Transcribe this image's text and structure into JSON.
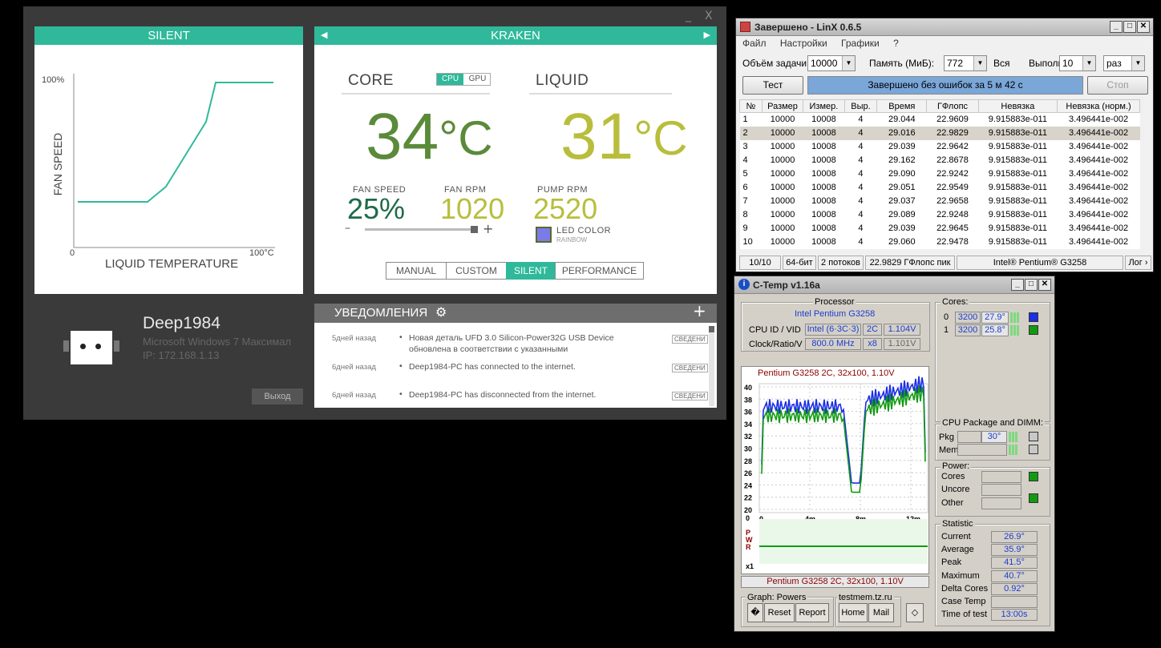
{
  "cam": {
    "window_controls": {
      "minimize": "_",
      "close": "X"
    },
    "silent": {
      "title": "SILENT",
      "y_top": "100%",
      "y_label": "FAN SPEED",
      "x_start": "0",
      "x_end": "100°C",
      "x_label": "LIQUID TEMPERATURE"
    },
    "kraken": {
      "title": "KRAKEN",
      "core_title": "CORE",
      "cpu_tab": "CPU",
      "gpu_tab": "GPU",
      "liquid_title": "LIQUID",
      "core_temp": "34",
      "liquid_temp": "31",
      "temp_unit": "°C",
      "fan_speed_label": "FAN SPEED",
      "fan_speed_value": "25%",
      "fan_rpm_label": "FAN RPM",
      "fan_rpm_value": "1020",
      "pump_rpm_label": "PUMP RPM",
      "pump_rpm_value": "2520",
      "led_color_label": "LED COLOR",
      "led_mode": "RAINBOW",
      "slider_minus": "–",
      "slider_plus": "+",
      "fan_speed_fraction": 0.98,
      "led_color": "#7b7be8",
      "modes": [
        "MANUAL",
        "CUSTOM",
        "SILENT",
        "PERFORMANCE"
      ],
      "active_mode": "SILENT"
    },
    "user": {
      "name": "Deep1984",
      "os": "Microsoft Windows 7 Максимал",
      "ip": "IP: 172.168.1.13",
      "logout": "Выход"
    },
    "notifications": {
      "title": "УВЕДОМЛЕНИЯ",
      "plus": "+",
      "items": [
        {
          "ago": "5дней назад",
          "text": "Новая деталь UFD 3.0 Silicon-Power32G USB Device обновлена в соответствии с указанными",
          "badge": "СВЕДЕНИ"
        },
        {
          "ago": "6дней назад",
          "text": "Deep1984-PC has connected to the internet.",
          "badge": "СВЕДЕНИ"
        },
        {
          "ago": "6дней назад",
          "text": "Deep1984-PC has disconnected from the internet.",
          "badge": "СВЕДЕНИ"
        }
      ]
    },
    "accent": "#2fb99a",
    "core_color": "#5a8a3a",
    "liquid_color": "#b8be3c"
  },
  "linx": {
    "title": "Завершено - LinX 0.6.5",
    "menu": [
      "Файл",
      "Настройки",
      "Графики",
      "?"
    ],
    "size_label": "Объём задачи:",
    "size_value": "10000",
    "mem_label": "Память (МиБ):",
    "mem_value": "772",
    "all_label": "Вся",
    "run_label": "Выполнять:",
    "run_value": "10",
    "run_unit": "раз",
    "test_button": "Тест",
    "progress_text": "Завершено без ошибок за 5 м 42 с",
    "progress_fraction": 1.0,
    "stop_button": "Стоп",
    "columns": [
      "№",
      "Размер",
      "Измер.",
      "Выр.",
      "Время",
      "ГФлопс",
      "Невязка",
      "Невязка (норм.)"
    ],
    "rows": [
      [
        "1",
        "10000",
        "10008",
        "4",
        "29.044",
        "22.9609",
        "9.915883e-011",
        "3.496441e-002"
      ],
      [
        "2",
        "10000",
        "10008",
        "4",
        "29.016",
        "22.9829",
        "9.915883e-011",
        "3.496441e-002"
      ],
      [
        "3",
        "10000",
        "10008",
        "4",
        "29.039",
        "22.9642",
        "9.915883e-011",
        "3.496441e-002"
      ],
      [
        "4",
        "10000",
        "10008",
        "4",
        "29.162",
        "22.8678",
        "9.915883e-011",
        "3.496441e-002"
      ],
      [
        "5",
        "10000",
        "10008",
        "4",
        "29.090",
        "22.9242",
        "9.915883e-011",
        "3.496441e-002"
      ],
      [
        "6",
        "10000",
        "10008",
        "4",
        "29.051",
        "22.9549",
        "9.915883e-011",
        "3.496441e-002"
      ],
      [
        "7",
        "10000",
        "10008",
        "4",
        "29.037",
        "22.9658",
        "9.915883e-011",
        "3.496441e-002"
      ],
      [
        "8",
        "10000",
        "10008",
        "4",
        "29.089",
        "22.9248",
        "9.915883e-011",
        "3.496441e-002"
      ],
      [
        "9",
        "10000",
        "10008",
        "4",
        "29.039",
        "22.9645",
        "9.915883e-011",
        "3.496441e-002"
      ],
      [
        "10",
        "10000",
        "10008",
        "4",
        "29.060",
        "22.9478",
        "9.915883e-011",
        "3.496441e-002"
      ]
    ],
    "selected_row": 1,
    "status": [
      "10/10",
      "64-бит",
      "2 потоков",
      "22.9829 ГФлопс пик",
      "Intel® Pentium® G3258",
      "Лог ›"
    ]
  },
  "ctemp": {
    "title": "C-Temp v1.16a",
    "processor_group": "Processor",
    "processor_name": "Intel Pentium  G3258",
    "cpuid_label": "CPU ID  / VID",
    "cpuid_value": "Intel (6·3C·3)",
    "cores_value": "2C",
    "vid_value": "1.104V",
    "clock_label": "Clock/Ratio/V",
    "clock_value": "800.0 MHz",
    "ratio_value": "x8",
    "volt_value": "1.101V",
    "cores_group": "Cores:",
    "cores": [
      {
        "idx": "0",
        "mhz": "3200",
        "temp": "27.9°",
        "color": "#1c2ee6"
      },
      {
        "idx": "1",
        "mhz": "3200",
        "temp": "25.8°",
        "color": "#119b11"
      }
    ],
    "graph_title": "Pentium  G3258 2C, 32x100, 1.10V",
    "graph_bottom_label": "Pentium  G3258 2C, 32x100, 1.10V",
    "y_ticks": [
      "40",
      "38",
      "36",
      "34",
      "32",
      "30",
      "28",
      "26",
      "24",
      "22",
      "20"
    ],
    "x_ticks": [
      "0",
      "4m",
      "8m",
      "12m"
    ],
    "pwr_labels": {
      "zero": "0",
      "p": "P",
      "w": "W",
      "r": "R",
      "x1": "x1"
    },
    "pkg_group": "CPU Package and DIMM:",
    "pkg_label": "Pkg",
    "pkg_value": "30°",
    "mem_label": "Mem",
    "power_group": "Power:",
    "power_items": [
      "Cores",
      "Uncore",
      "Other"
    ],
    "stat_group": "Statistic",
    "stats": [
      {
        "label": "Current",
        "value": "26.9°"
      },
      {
        "label": "Average",
        "value": "35.9°"
      },
      {
        "label": "Peak",
        "value": "41.5°"
      },
      {
        "label": "Maximum",
        "value": "40.7°"
      },
      {
        "label": "Delta Cores",
        "value": "0.92°"
      },
      {
        "label": "Case Temp",
        "value": ""
      },
      {
        "label": "Time of test",
        "value": "13:00s"
      }
    ],
    "graph_group": "Graph: Powers",
    "url_group": "testmem.tz.ru",
    "buttons": {
      "icon": "�",
      "reset": "Reset",
      "report": "Report",
      "home": "Home",
      "mail": "Mail",
      "diamond": "◇"
    }
  }
}
